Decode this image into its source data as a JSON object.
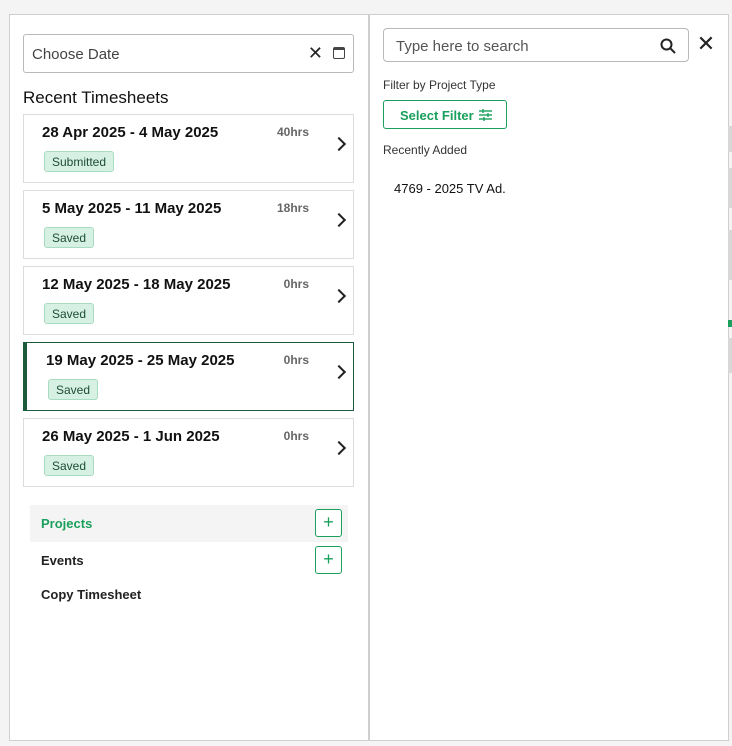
{
  "date_picker": {
    "placeholder": "Choose Date",
    "clear_glyph": "✕",
    "icon": "calendar-icon"
  },
  "section_title": "Recent Timesheets",
  "timesheets": [
    {
      "range": "28 Apr 2025 - 4 May 2025",
      "hours": "40hrs",
      "status": "Submitted"
    },
    {
      "range": "5 May 2025 - 11 May 2025",
      "hours": "18hrs",
      "status": "Saved"
    },
    {
      "range": "12 May 2025 - 18 May 2025",
      "hours": "0hrs",
      "status": "Saved"
    },
    {
      "range": "19 May 2025 - 25 May 2025",
      "hours": "0hrs",
      "status": "Saved"
    },
    {
      "range": "26 May 2025 - 1 Jun 2025",
      "hours": "0hrs",
      "status": "Saved"
    }
  ],
  "menu": [
    {
      "label": "Projects",
      "add": "+"
    },
    {
      "label": "Events",
      "add": "+"
    },
    {
      "label": "Copy Timesheet"
    }
  ],
  "search_panel": {
    "placeholder": "Type here to search",
    "close_glyph": "✕",
    "filter_label": "Filter by Project Type",
    "filter_button": "Select Filter",
    "recent_label": "Recently Added",
    "recent_items": [
      "4769 - 2025 TV Ad."
    ]
  },
  "colors": {
    "accent": "#1aa05c",
    "active_border": "#1d5b3d",
    "badge_bg": "#d6f1e3"
  }
}
